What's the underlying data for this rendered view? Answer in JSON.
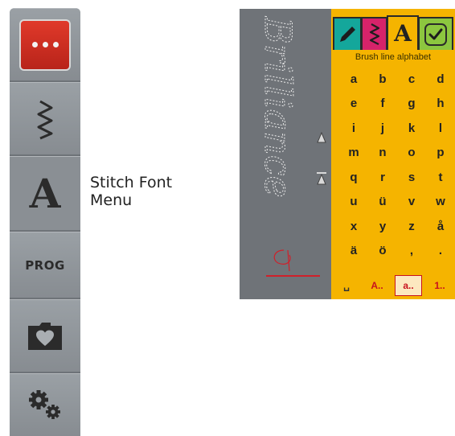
{
  "sidebar": {
    "items": [
      {
        "name": "more-options",
        "icon": "three-dots-icon"
      },
      {
        "name": "stitch-menu",
        "icon": "zigzag-stitch-icon"
      },
      {
        "name": "stitch-font-menu",
        "icon": "letter-a-icon",
        "label": "A"
      },
      {
        "name": "program",
        "icon": "prog-icon",
        "label": "PROG"
      },
      {
        "name": "personal-menu",
        "icon": "folder-heart-icon"
      },
      {
        "name": "settings",
        "icon": "gears-icon"
      }
    ]
  },
  "callout": {
    "text": "Stitch Font\nMenu"
  },
  "screen": {
    "preview_text": "Brilliance",
    "tabs": [
      {
        "name": "pencil",
        "color": "#14a79b"
      },
      {
        "name": "zigzag",
        "color": "#d6236a"
      },
      {
        "name": "alphabet",
        "label": "A",
        "color": "#f5b400"
      },
      {
        "name": "confirm",
        "color": "#8cc63f"
      }
    ],
    "panel_title": "Brush line alphabet",
    "letters": [
      [
        "a",
        "b",
        "c",
        "d"
      ],
      [
        "e",
        "f",
        "g",
        "h"
      ],
      [
        "i",
        "j",
        "k",
        "l"
      ],
      [
        "m",
        "n",
        "o",
        "p"
      ],
      [
        "q",
        "r",
        "s",
        "t"
      ],
      [
        "u",
        "ü",
        "v",
        "w"
      ],
      [
        "x",
        "y",
        "z",
        "å"
      ],
      [
        "ä",
        "ö",
        ",",
        "."
      ]
    ],
    "modes": [
      {
        "label": "A..",
        "selected": false
      },
      {
        "label": "a..",
        "selected": true
      },
      {
        "label": "1..",
        "selected": false
      }
    ],
    "space_symbol": "␣"
  }
}
